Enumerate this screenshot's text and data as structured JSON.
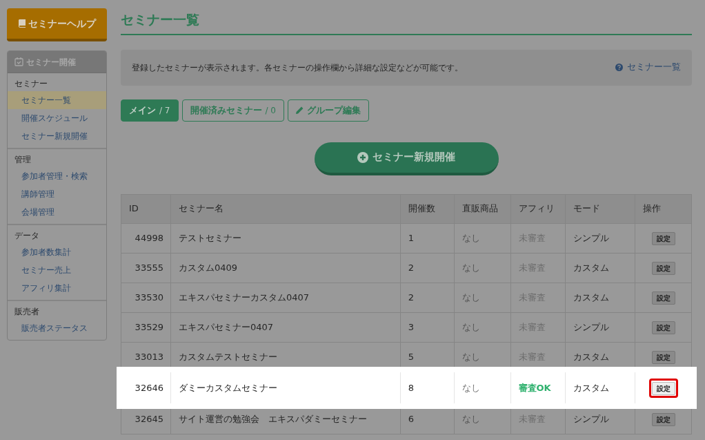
{
  "help_button": {
    "label": "セミナーヘルプ"
  },
  "sidebar": {
    "title": "セミナー開催",
    "groups": [
      {
        "heading": "セミナー",
        "items": [
          {
            "label": "セミナー一覧",
            "selected": true
          },
          {
            "label": "開催スケジュール",
            "selected": false
          },
          {
            "label": "セミナー新規開催",
            "selected": false
          }
        ]
      },
      {
        "heading": "管理",
        "items": [
          {
            "label": "参加者管理・検索",
            "selected": false
          },
          {
            "label": "講師管理",
            "selected": false
          },
          {
            "label": "会場管理",
            "selected": false
          }
        ]
      },
      {
        "heading": "データ",
        "items": [
          {
            "label": "参加者数集計",
            "selected": false
          },
          {
            "label": "セミナー売上",
            "selected": false
          },
          {
            "label": "アフィリ集計",
            "selected": false
          }
        ]
      },
      {
        "heading": "販売者",
        "items": [
          {
            "label": "販売者ステータス",
            "selected": false
          }
        ]
      }
    ]
  },
  "page_title": "セミナー一覧",
  "info": {
    "text": "登録したセミナーが表示されます。各セミナーの操作欄から詳細な設定などが可能です。",
    "help_link": "セミナー一覧"
  },
  "tabs": [
    {
      "kind": "tab",
      "label": "メイン",
      "count": "/ 7",
      "selected": true
    },
    {
      "kind": "tab",
      "label": "開催済みセミナー",
      "count": "/ 0",
      "selected": false
    },
    {
      "kind": "edit",
      "label": "グループ編集",
      "selected": false
    }
  ],
  "new_button": {
    "label": "セミナー新規開催"
  },
  "table": {
    "columns": [
      "ID",
      "セミナー名",
      "開催数",
      "直販商品",
      "アフィリ",
      "モード",
      "操作"
    ],
    "rows": [
      {
        "id": "44998",
        "name": "テストセミナー",
        "count": "1",
        "direct": "なし",
        "affiliate": "未審査",
        "approved": false,
        "mode": "シンプル",
        "action": "設定",
        "highlighted": false
      },
      {
        "id": "33555",
        "name": "カスタム0409",
        "count": "2",
        "direct": "なし",
        "affiliate": "未審査",
        "approved": false,
        "mode": "カスタム",
        "action": "設定",
        "highlighted": false
      },
      {
        "id": "33530",
        "name": "エキスパセミナーカスタム0407",
        "count": "2",
        "direct": "なし",
        "affiliate": "未審査",
        "approved": false,
        "mode": "カスタム",
        "action": "設定",
        "highlighted": false
      },
      {
        "id": "33529",
        "name": "エキスパセミナー0407",
        "count": "3",
        "direct": "なし",
        "affiliate": "未審査",
        "approved": false,
        "mode": "シンプル",
        "action": "設定",
        "highlighted": false
      },
      {
        "id": "33013",
        "name": "カスタムテストセミナー",
        "count": "5",
        "direct": "なし",
        "affiliate": "未審査",
        "approved": false,
        "mode": "カスタム",
        "action": "設定",
        "highlighted": false
      },
      {
        "id": "32646",
        "name": "ダミーカスタムセミナー",
        "count": "8",
        "direct": "なし",
        "affiliate": "審査OK",
        "approved": true,
        "mode": "カスタム",
        "action": "設定",
        "highlighted": true
      },
      {
        "id": "32645",
        "name": "サイト運営の勉強会　エキスパダミーセミナー",
        "count": "6",
        "direct": "なし",
        "affiliate": "未審査",
        "approved": false,
        "mode": "シンプル",
        "action": "設定",
        "highlighted": false
      }
    ]
  }
}
